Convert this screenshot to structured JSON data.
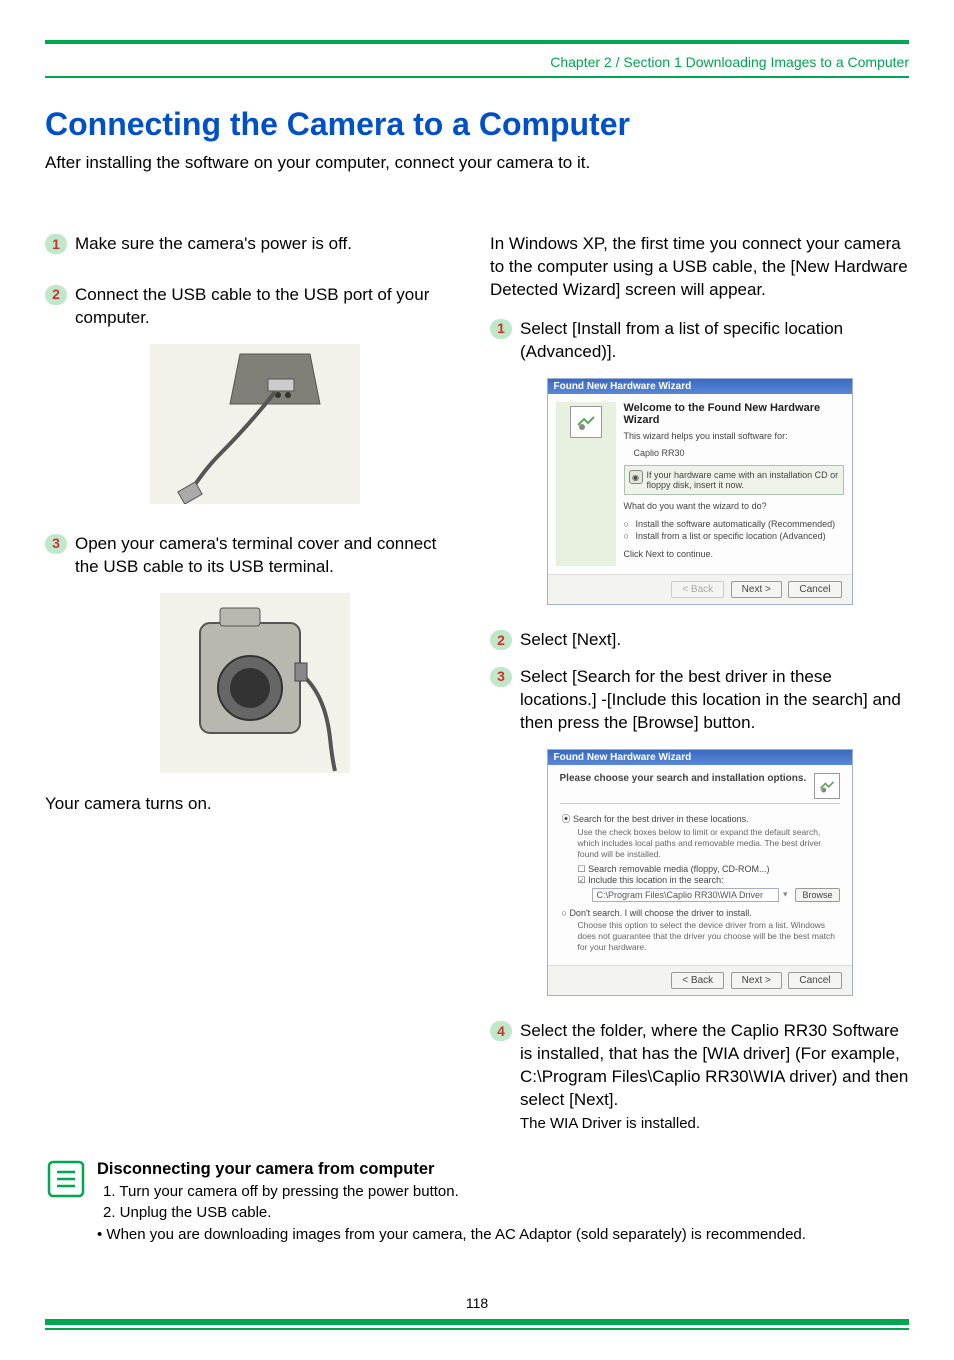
{
  "breadcrumb": "Chapter 2 / Section 1  Downloading Images to a Computer",
  "title": "Connecting the Camera to a Computer",
  "intro": "After installing the software on your computer, connect your camera to it.",
  "left": {
    "steps": [
      {
        "n": "1",
        "t": "Make sure the camera's power is off."
      },
      {
        "n": "2",
        "t": "Connect the USB cable to the USB port of your computer."
      },
      {
        "n": "3",
        "t": "Open your camera's terminal cover and connect the USB cable to its USB terminal."
      }
    ],
    "caption": "Your camera turns on."
  },
  "right": {
    "lead": "In Windows XP, the first time you connect your camera to the computer using a USB cable, the [New Hardware Detected Wizard] screen will appear.",
    "steps": [
      {
        "n": "1",
        "t": "Select [Install from a list of specific location (Advanced)]."
      },
      {
        "n": "2",
        "t": "Select [Next]."
      },
      {
        "n": "3",
        "t": "Select [Search for the best driver in these locations.] -[Include this location in the search] and then press the [Browse] button."
      },
      {
        "n": "4",
        "t": "Select the folder, where the Caplio RR30 Software is installed, that has the [WIA driver] (For example, C:\\Program Files\\Caplio RR30\\WIA driver) and then select [Next]."
      }
    ],
    "sub4": "The WIA Driver is installed.",
    "wizard1": {
      "title": "Found New Hardware Wizard",
      "heading": "Welcome to the Found New Hardware Wizard",
      "p1": "This wizard helps you install software for:",
      "device": "Caplio RR30",
      "hint": "If your hardware came with an installation CD or floppy disk, insert it now.",
      "q": "What do you want the wizard to do?",
      "opt1": "Install the software automatically (Recommended)",
      "opt2": "Install from a list or specific location (Advanced)",
      "cont": "Click Next to continue.",
      "back": "< Back",
      "next": "Next >",
      "cancel": "Cancel"
    },
    "wizard2": {
      "title": "Found New Hardware Wizard",
      "heading": "Please choose your search and installation options.",
      "opt1": "Search for the best driver in these locations.",
      "opt1_desc": "Use the check boxes below to limit or expand the default search, which includes local paths and removable media. The best driver found will be installed.",
      "chk1": "Search removable media (floppy, CD-ROM...)",
      "chk2": "Include this location in the search:",
      "path": "C:\\Program Files\\Caplio RR30\\WIA Driver",
      "browse": "Browse",
      "opt2": "Don't search. I will choose the driver to install.",
      "opt2_desc": "Choose this option to select the device driver from a list. Windows does not guarantee that the driver you choose will be the best match for your hardware.",
      "back": "< Back",
      "next": "Next >",
      "cancel": "Cancel"
    }
  },
  "tip": {
    "heading": "Disconnecting your camera from computer",
    "li1": " 1. Turn your camera off by pressing the power button.",
    "li2": " 2. Unplug the USB cable.",
    "note": "When you are downloading images from your camera, the AC Adaptor (sold separately) is recommended."
  },
  "page_number": "118"
}
